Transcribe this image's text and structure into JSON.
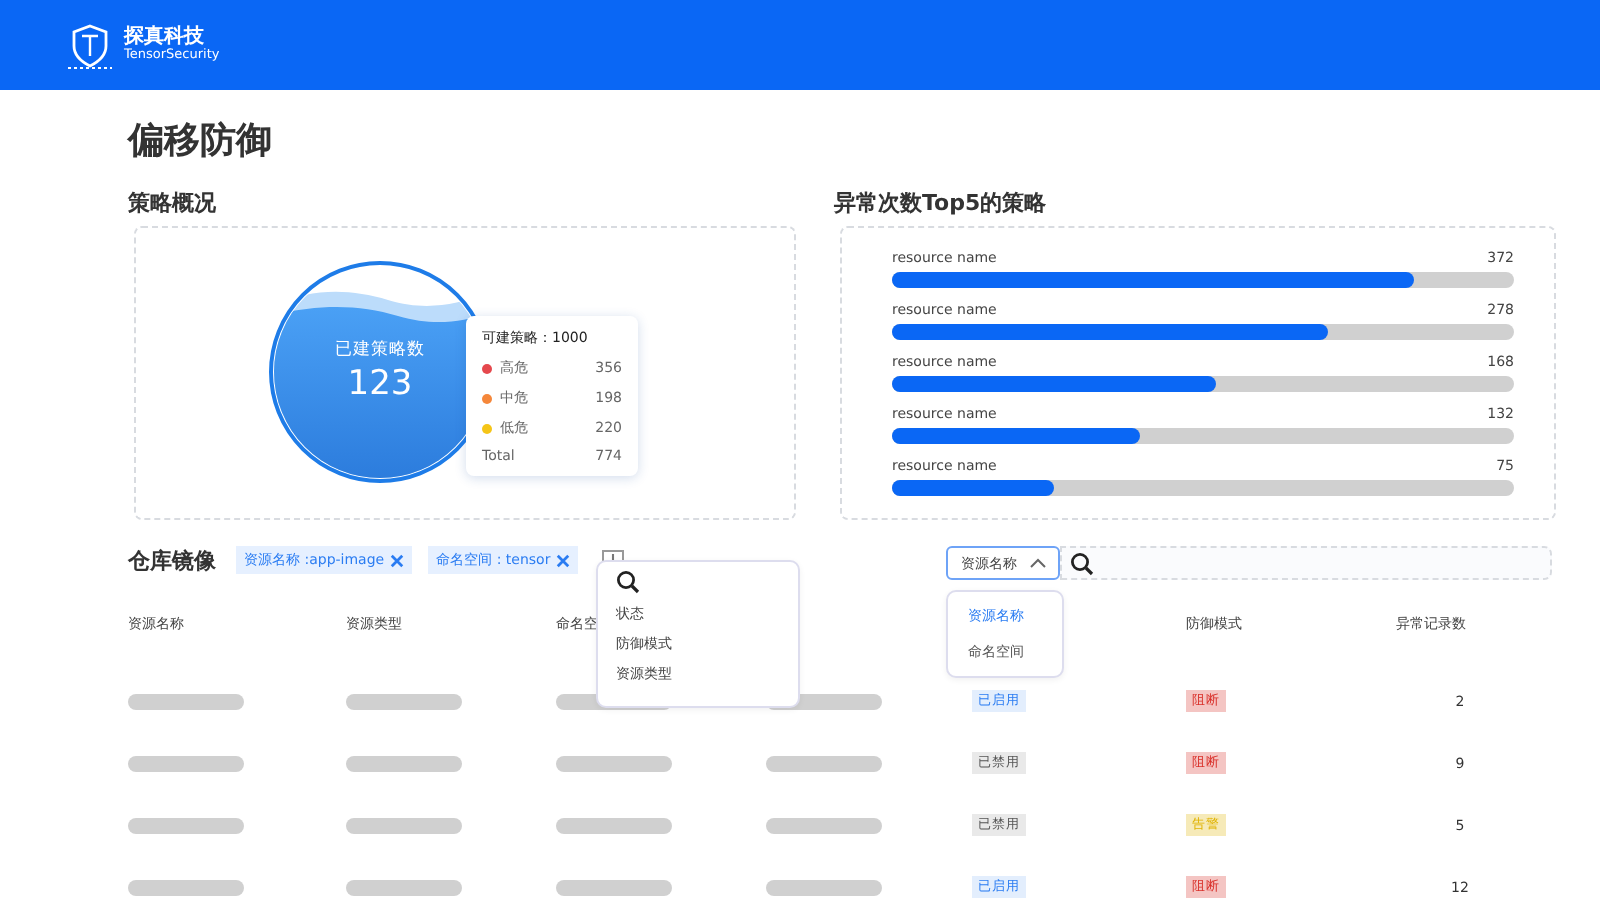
{
  "header": {
    "brand": "探真科技",
    "brand_sub": "TensorSecurity"
  },
  "page_title": "偏移防御",
  "overview": {
    "title": "策略概况",
    "gauge_label": "已建策略数",
    "gauge_value": "123",
    "tooltip": {
      "title": "可建策略：1000",
      "items": [
        {
          "label": "高危",
          "value": "356",
          "color": "#e5484d"
        },
        {
          "label": "中危",
          "value": "198",
          "color": "#f5873a"
        },
        {
          "label": "低危",
          "value": "220",
          "color": "#f5c518"
        }
      ],
      "total_label": "Total",
      "total_value": "774"
    }
  },
  "top5": {
    "title": "异常次数Top5的策略",
    "items": [
      {
        "name": "resource name",
        "value": "372",
        "level": 0.84
      },
      {
        "name": "resource name",
        "value": "278",
        "level": 0.7
      },
      {
        "name": "resource name",
        "value": "168",
        "level": 0.52
      },
      {
        "name": "resource name",
        "value": "132",
        "level": 0.4
      },
      {
        "name": "resource name",
        "value": "75",
        "level": 0.26
      }
    ]
  },
  "images": {
    "title": "仓库镜像",
    "filters": [
      {
        "label": "资源名称 :app-image"
      },
      {
        "label": "命名空间 : tensor"
      }
    ],
    "add_menu": {
      "items": [
        "状态",
        "防御模式",
        "资源类型"
      ]
    },
    "field_select": {
      "value": "资源名称",
      "options": [
        {
          "label": "资源名称",
          "selected": true
        },
        {
          "label": "命名空间",
          "selected": false
        }
      ]
    },
    "columns": [
      {
        "label": "资源名称"
      },
      {
        "label": "资源类型"
      },
      {
        "label": "命名空"
      },
      {},
      {},
      {
        "label": "防御模式"
      },
      {
        "label": "异常记录数"
      }
    ],
    "rows": [
      {
        "status": {
          "label": "已启用",
          "color": "#2a7cf2"
        },
        "mode": {
          "label": "阻断",
          "color": "#d9302a"
        },
        "count": "2"
      },
      {
        "status": {
          "label": "已禁用",
          "color": "#555555"
        },
        "mode": {
          "label": "阻断",
          "color": "#d9302a"
        },
        "count": "9"
      },
      {
        "status": {
          "label": "已禁用",
          "color": "#555555"
        },
        "mode": {
          "label": "告警",
          "color": "#e0b300"
        },
        "count": "5"
      },
      {
        "status": {
          "label": "已启用",
          "color": "#2a7cf2"
        },
        "mode": {
          "label": "阻断",
          "color": "#d9302a"
        },
        "count": "12"
      }
    ]
  }
}
